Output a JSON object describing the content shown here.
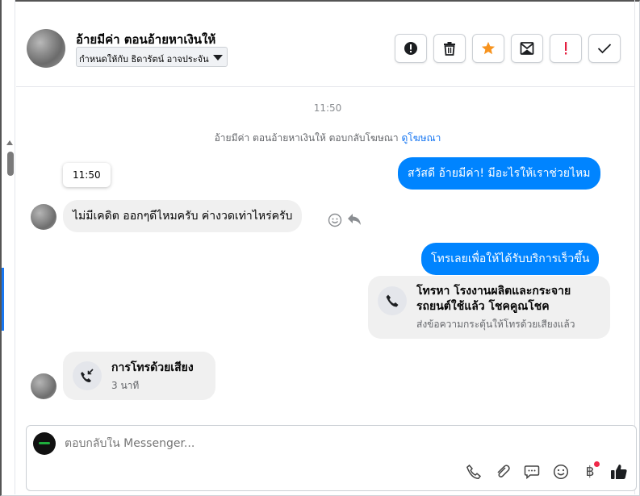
{
  "header": {
    "contact_name": "อ้ายมีค่า ตอนอ้ายหาเงินให้",
    "assignee_label": "กำหนดให้กับ ธิดารัตน์ อาจประจัน",
    "actions": [
      {
        "icon": "alert-circle-icon"
      },
      {
        "icon": "trash-icon"
      },
      {
        "icon": "star-icon",
        "color": "#f7931e"
      },
      {
        "icon": "archive-envelope-icon"
      },
      {
        "icon": "exclamation-icon",
        "color": "#e41e3f"
      },
      {
        "icon": "check-icon"
      }
    ]
  },
  "chat": {
    "top_time": "11:50",
    "ad_note_text": "อ้ายมีค่า ตอนอ้ายหาเงินให้ ตอบกลับโฆษณา",
    "ad_note_link": "ดูโฆษณา",
    "tooltip_time": "11:50",
    "messages": [
      {
        "from": "page",
        "text": "สวัสดี อ้ายมีค่า! มีอะไรให้เราช่วยไหม"
      },
      {
        "from": "contact",
        "text": "ไม่มีเคดิต ออกๆดีไหมครับ ค่างวดเท่าไหร่ครับ"
      },
      {
        "from": "page",
        "text": "โทรเลยเพื่อให้ได้รับบริการเร็วขึ้น"
      }
    ],
    "call_prompt": {
      "title_line1": "โทรหา โรงงานผลิตและกระจาย",
      "title_line2": "รถยนต์ใช้แล้ว โชคคูณโชค",
      "subtitle": "ส่งข้อความกระตุ้นให้โทรด้วยเสียงแล้ว"
    },
    "voice_call": {
      "title": "การโทรด้วยเสียง",
      "duration": "3 นาที"
    }
  },
  "composer": {
    "placeholder": "ตอบกลับใน Messenger...",
    "tools": [
      "phone-icon",
      "paperclip-icon",
      "speech-bubble-icon",
      "emoji-icon",
      "baht-icon",
      "thumbs-up-icon"
    ],
    "baht_symbol": "฿",
    "accent_color": "#1877f2"
  }
}
